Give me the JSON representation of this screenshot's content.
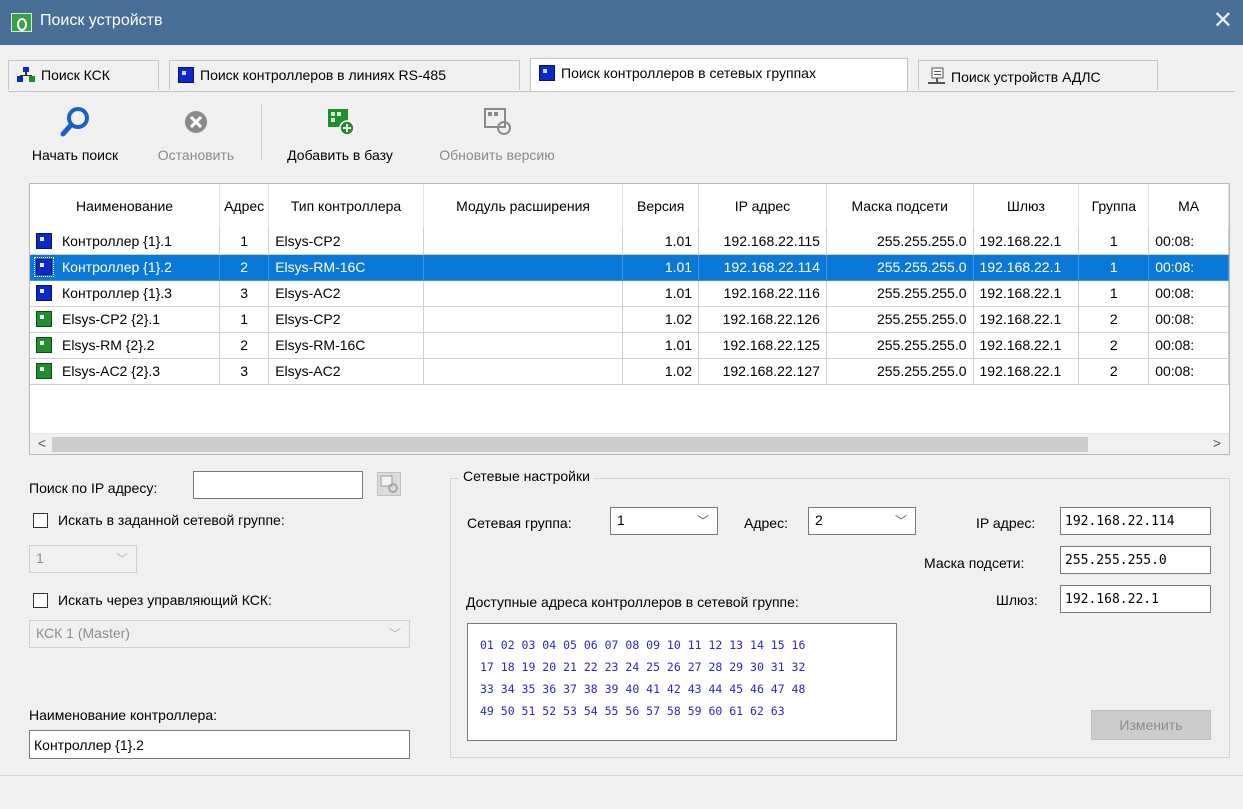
{
  "window": {
    "title": "Поиск устройств",
    "close_glyph": "✕"
  },
  "tabs": [
    {
      "label": "Поиск КСК",
      "icon": "network-icon"
    },
    {
      "label": "Поиск контроллеров в линиях RS-485",
      "icon": "controller-icon"
    },
    {
      "label": "Поиск контроллеров в сетевых группах",
      "icon": "controller-icon",
      "active": true
    },
    {
      "label": "Поиск устройств АДЛС",
      "icon": "monitor-icon"
    }
  ],
  "toolbar": {
    "start": "Начать поиск",
    "stop": "Остановить",
    "add": "Добавить в базу",
    "update": "Обновить версию"
  },
  "table": {
    "columns": [
      "Наименование",
      "Адрес",
      "Тип контроллера",
      "Модуль расширения",
      "Версия",
      "IP адрес",
      "Маска подсети",
      "Шлюз",
      "Группа",
      "MA"
    ],
    "rows": [
      {
        "name": "Контроллер {1}.1",
        "icon": "blue",
        "address": "1",
        "type": "Elsys-CP2",
        "module": "",
        "version": "1.01",
        "ip": "192.168.22.115",
        "mask": "255.255.255.0",
        "gateway": "192.168.22.1",
        "group": "1",
        "mac": "00:08:"
      },
      {
        "name": "Контроллер {1}.2",
        "icon": "blue",
        "address": "2",
        "type": "Elsys-RM-16C",
        "module": "",
        "version": "1.01",
        "ip": "192.168.22.114",
        "mask": "255.255.255.0",
        "gateway": "192.168.22.1",
        "group": "1",
        "mac": "00:08:",
        "selected": true
      },
      {
        "name": "Контроллер {1}.3",
        "icon": "blue",
        "address": "3",
        "type": "Elsys-AC2",
        "module": "",
        "version": "1.01",
        "ip": "192.168.22.116",
        "mask": "255.255.255.0",
        "gateway": "192.168.22.1",
        "group": "1",
        "mac": "00:08:"
      },
      {
        "name": "Elsys-CP2 {2}.1",
        "icon": "green",
        "address": "1",
        "type": "Elsys-CP2",
        "module": "",
        "version": "1.02",
        "ip": "192.168.22.126",
        "mask": "255.255.255.0",
        "gateway": "192.168.22.1",
        "group": "2",
        "mac": "00:08:"
      },
      {
        "name": "Elsys-RM {2}.2",
        "icon": "green",
        "address": "2",
        "type": "Elsys-RM-16C",
        "module": "",
        "version": "1.01",
        "ip": "192.168.22.125",
        "mask": "255.255.255.0",
        "gateway": "192.168.22.1",
        "group": "2",
        "mac": "00:08:"
      },
      {
        "name": "Elsys-AC2 {2}.3",
        "icon": "green",
        "address": "3",
        "type": "Elsys-AC2",
        "module": "",
        "version": "1.02",
        "ip": "192.168.22.127",
        "mask": "255.255.255.0",
        "gateway": "192.168.22.1",
        "group": "2",
        "mac": "00:08:"
      }
    ]
  },
  "left": {
    "search_ip_label": "Поиск по IP адресу:",
    "search_ip_value": "",
    "search_group_label": "Искать в заданной сетевой группе:",
    "group_value": "1",
    "search_ksk_label": "Искать через управляющий КСК:",
    "ksk_value": "КСК 1 (Master)",
    "controller_name_label": "Наименование контроллера:",
    "controller_name_value": "Контроллер {1}.2"
  },
  "network": {
    "title": "Сетевые настройки",
    "group_label": "Сетевая группа:",
    "group_value": "1",
    "address_label": "Адрес:",
    "address_value": "2",
    "ip_label": "IP адрес:",
    "ip_value": "192.168.22.114",
    "mask_label": "Маска подсети:",
    "mask_value": "255.255.255.0",
    "gateway_label": "Шлюз:",
    "gateway_value": "192.168.22.1",
    "available_label": "Доступные адреса контроллеров в сетевой группе:",
    "available_lines": [
      "01 02 03 04 05 06 07 08 09 10 11 12 13 14 15 16",
      "17 18 19 20 21 22 23 24 25 26 27 28 29 30 31 32",
      "33 34 35 36 37 38 39 40 41 42 43 44 45 46 47 48",
      "49 50 51 52 53 54 55 56 57 58 59 60 61 62 63"
    ],
    "change_button": "Изменить"
  },
  "colors": {
    "titlebar": "#4a6f97",
    "selection": "#0a78d6",
    "address_text": "#2828c8"
  }
}
